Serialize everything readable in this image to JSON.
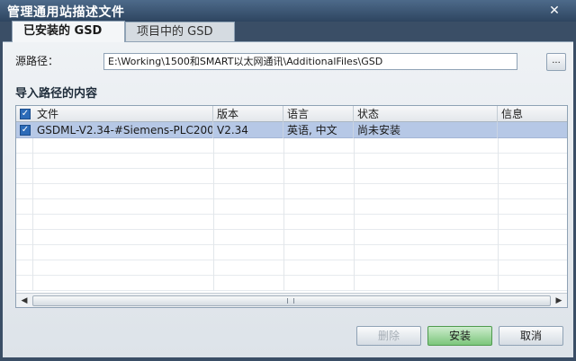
{
  "window": {
    "title": "管理通用站描述文件"
  },
  "tabs": [
    {
      "label": "已安装的 GSD"
    },
    {
      "label": "项目中的 GSD"
    }
  ],
  "source": {
    "label": "源路径：",
    "value": "E:\\Working\\1500和SMART以太网通讯\\AdditionalFiles\\GSD",
    "browse_label": "..."
  },
  "section": {
    "title": "导入路径的内容"
  },
  "table": {
    "columns": [
      "文件",
      "版本",
      "语言",
      "状态",
      "信息"
    ],
    "rows": [
      {
        "file": "GSDML-V2.34-#Siemens-PLC200s...",
        "version": "V2.34",
        "language": "英语, 中文",
        "status": "尚未安装",
        "info": "",
        "checked": true
      }
    ]
  },
  "buttons": {
    "delete": "删除",
    "install": "安装",
    "cancel": "取消"
  },
  "colors": {
    "selected_row": "#b6c8e6",
    "install_button": "#7cc67c",
    "title_bar": "#2e4560"
  },
  "icons": {
    "close": "close-icon",
    "checkbox": "checkbox-checked-icon"
  }
}
